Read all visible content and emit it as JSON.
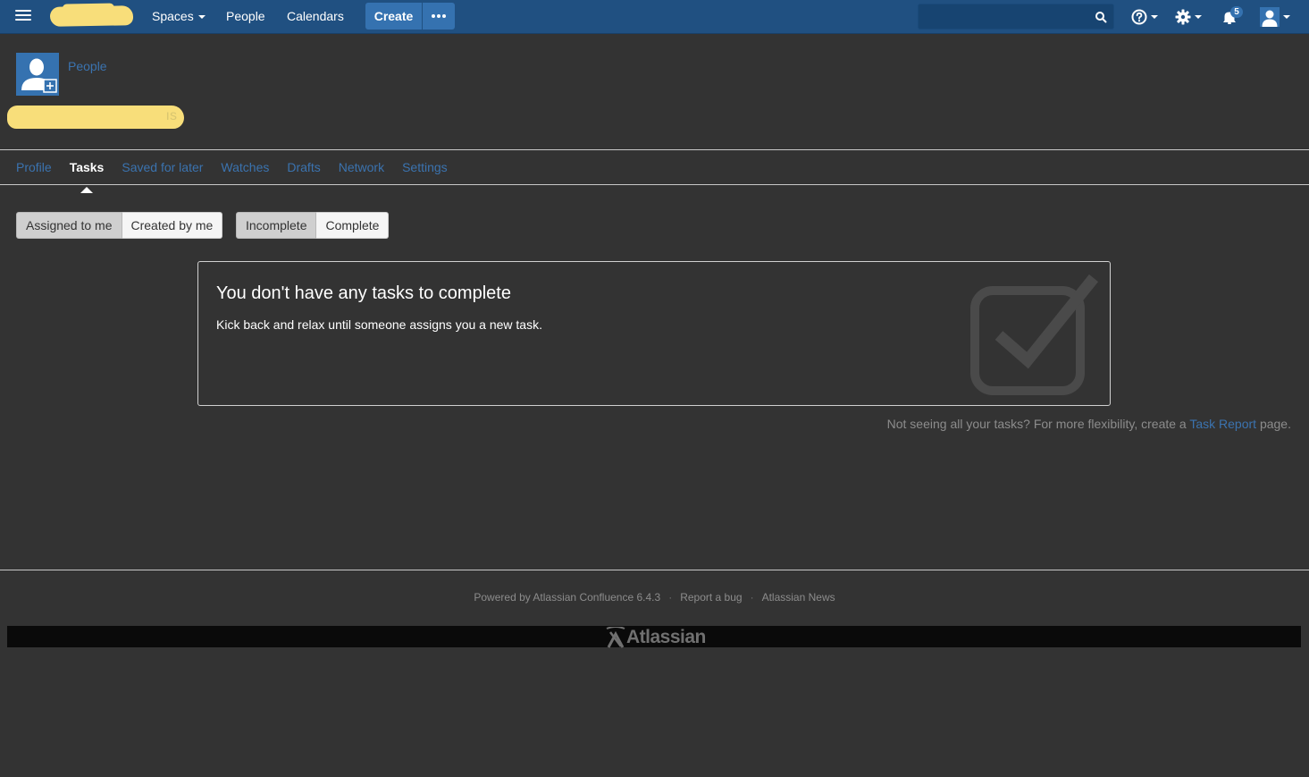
{
  "header": {
    "nav": [
      {
        "label": "Spaces",
        "has_dropdown": true
      },
      {
        "label": "People",
        "has_dropdown": false
      },
      {
        "label": "Calendars",
        "has_dropdown": false
      }
    ],
    "create_label": "Create",
    "search_value": "",
    "notification_count": "5",
    "icons": [
      "menu-icon",
      "help-icon",
      "gear-icon",
      "notification-icon",
      "user-icon"
    ],
    "colors": {
      "bar": "#205081",
      "button": "#3572b0"
    }
  },
  "page": {
    "breadcrumb": "People",
    "tabs": [
      {
        "label": "Profile",
        "active": false
      },
      {
        "label": "Tasks",
        "active": true
      },
      {
        "label": "Saved for later",
        "active": false
      },
      {
        "label": "Watches",
        "active": false
      },
      {
        "label": "Drafts",
        "active": false
      },
      {
        "label": "Network",
        "active": false
      },
      {
        "label": "Settings",
        "active": false
      }
    ]
  },
  "filters": {
    "assignment": [
      {
        "label": "Assigned to me",
        "active": true
      },
      {
        "label": "Created by me",
        "active": false
      }
    ],
    "status": [
      {
        "label": "Incomplete",
        "active": true
      },
      {
        "label": "Complete",
        "active": false
      }
    ]
  },
  "empty_state": {
    "title": "You don't have any tasks to complete",
    "message": "Kick back and relax until someone assigns you a new task.",
    "icon": "checkbox-checked-icon"
  },
  "hint": {
    "prefix": "Not seeing all your tasks? For more flexibility, create a ",
    "link": "Task Report",
    "suffix": " page."
  },
  "footer": {
    "powered_by": "Powered by Atlassian Confluence 6.4.3",
    "report_bug": "Report a bug",
    "news": "Atlassian News",
    "logo_text": "Atlassian"
  }
}
